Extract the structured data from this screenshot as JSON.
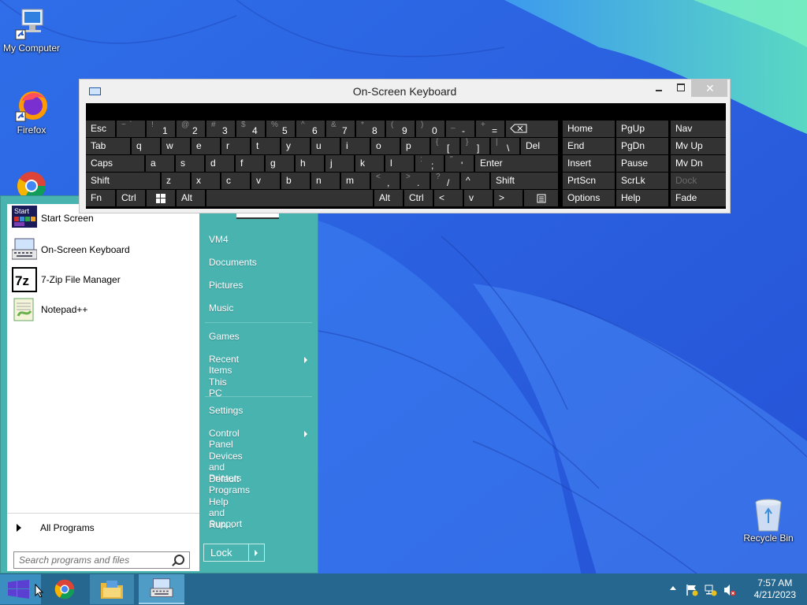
{
  "desktop": {
    "icons": [
      {
        "label": "My Computer"
      },
      {
        "label": "Firefox"
      },
      {
        "label": "Recycle Bin"
      }
    ]
  },
  "start_menu": {
    "programs": [
      {
        "label": "Start Screen",
        "icon": "start-screen-icon"
      },
      {
        "label": "On-Screen Keyboard",
        "icon": "keyboard-icon"
      },
      {
        "label": "7-Zip File Manager",
        "icon": "7zip-icon"
      },
      {
        "label": "Notepad++",
        "icon": "notepadpp-icon"
      }
    ],
    "start_screen_badge": "Start",
    "sevenzip_badge": "7z",
    "all_programs": "All Programs",
    "search_placeholder": "Search programs and files",
    "right_links": {
      "user": "VM4",
      "documents": "Documents",
      "pictures": "Pictures",
      "music": "Music",
      "games": "Games",
      "recent_items": "Recent Items",
      "this_pc": "This PC",
      "settings": "Settings",
      "control_panel": "Control Panel",
      "devices_printers": "Devices and Printers",
      "default_programs": "Default Programs",
      "help_support": "Help and Support",
      "run": "Run..."
    },
    "lock_label": "Lock"
  },
  "osk": {
    "title": "On-Screen Keyboard",
    "row1": [
      {
        "m": "Esc"
      },
      {
        "s": "~",
        "s2": "`"
      },
      {
        "s": "!",
        "b": "1"
      },
      {
        "s": "@",
        "b": "2"
      },
      {
        "s": "#",
        "b": "3"
      },
      {
        "s": "$",
        "b": "4"
      },
      {
        "s": "%",
        "b": "5"
      },
      {
        "s": "^",
        "b": "6"
      },
      {
        "s": "&",
        "b": "7"
      },
      {
        "s": "*",
        "b": "8"
      },
      {
        "s": "(",
        "b": "9"
      },
      {
        "s": ")",
        "b": "0"
      },
      {
        "s": "_",
        "b": "-"
      },
      {
        "s": "+",
        "b": "="
      }
    ],
    "row2": {
      "tab": "Tab",
      "letters": [
        "q",
        "w",
        "e",
        "r",
        "t",
        "y",
        "u",
        "i",
        "o",
        "p"
      ],
      "lbr": {
        "s": "{",
        "b": "["
      },
      "rbr": {
        "s": "}",
        "b": "]"
      },
      "pipe": {
        "s": "|",
        "b": "\\"
      },
      "del": "Del"
    },
    "row3": {
      "caps": "Caps",
      "letters": [
        "a",
        "s",
        "d",
        "f",
        "g",
        "h",
        "j",
        "k",
        "l"
      ],
      "semi": {
        "s": ":",
        "b": ";"
      },
      "quote": {
        "s": "\"",
        "b": "'"
      },
      "enter": "Enter"
    },
    "row4": {
      "shift": "Shift",
      "letters": [
        "z",
        "x",
        "c",
        "v",
        "b",
        "n",
        "m"
      ],
      "comma": {
        "s": "<",
        "b": ","
      },
      "period": {
        "s": ">",
        "b": "."
      },
      "slash": {
        "s": "?",
        "b": "/"
      },
      "up": "^",
      "shift_r": "Shift"
    },
    "row5": {
      "fn": "Fn",
      "ctrl": "Ctrl",
      "alt": "Alt",
      "alt_r": "Alt",
      "ctrl_r": "Ctrl",
      "left": "<",
      "down": "v",
      "right": ">"
    },
    "nav": {
      "home": "Home",
      "pgup": "PgUp",
      "nav": "Nav",
      "end": "End",
      "pgdn": "PgDn",
      "mvup": "Mv Up",
      "insert": "Insert",
      "pause": "Pause",
      "mvdn": "Mv Dn",
      "prtscn": "PrtScn",
      "scrlk": "ScrLk",
      "dock": "Dock",
      "options": "Options",
      "help": "Help",
      "fade": "Fade"
    }
  },
  "taskbar": {
    "time": "7:57 AM",
    "date": "4/21/2023"
  },
  "colors": {
    "start_menu_bg": "#49b3b0",
    "taskbar_bg": "#25678f",
    "osk_key_bg": "#333333"
  }
}
